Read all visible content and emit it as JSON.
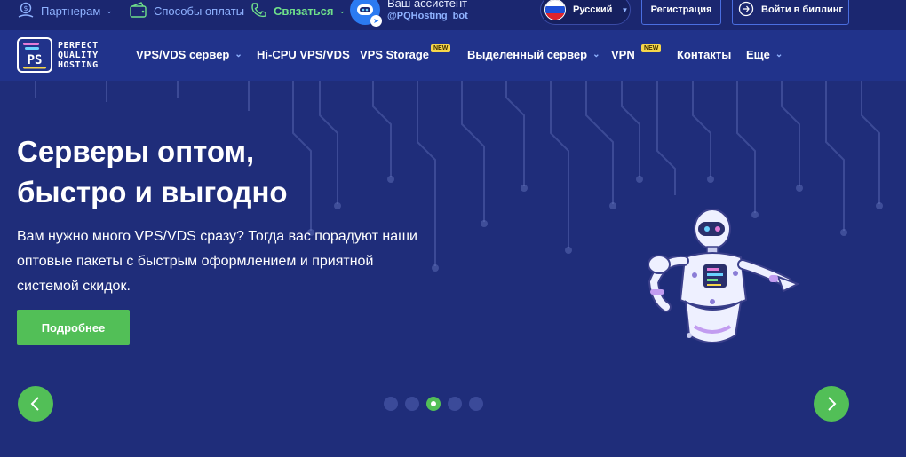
{
  "topbar": {
    "partners": "Партнерам",
    "payment": "Способы оплаты",
    "contact": "Связаться",
    "assistant_title": "Ваш ассистент",
    "assistant_handle": "@PQHosting_bot",
    "language": "Русский",
    "register": "Регистрация",
    "billing": "Войти в биллинг"
  },
  "logo": {
    "line1": "PERFECT",
    "line2": "QUALITY",
    "line3": "HOSTING"
  },
  "nav": {
    "items": [
      {
        "label": "VPS/VDS сервер"
      },
      {
        "label": "Hi-CPU VPS/VDS"
      },
      {
        "label": "VPS Storage"
      },
      {
        "label": "Выделенный сервер"
      },
      {
        "label": "VPN"
      },
      {
        "label": "Контакты"
      },
      {
        "label": "Еще"
      }
    ],
    "new_badge": "NEW"
  },
  "hero": {
    "title_line1": "Серверы оптом,",
    "title_line2": "быстро и выгодно",
    "subtitle": "Вам нужно много VPS/VDS сразу? Тогда вас порадуют наши оптовые пакеты с быстрым оформлением и приятной системой скидок.",
    "button": "Подробнее"
  },
  "slider": {
    "count": 5,
    "active": 3
  },
  "colors": {
    "background": "#1f2d7a",
    "accent_green": "#52bf57",
    "link_blue": "#8fb2ff",
    "contact_green": "#6fe08a",
    "badge_yellow": "#f6d64a"
  },
  "icons": {
    "partners": "dollar-hand-icon",
    "payment": "wallet-icon",
    "contact": "phone-icon",
    "assistant": "robot-avatar-icon",
    "billing": "login-arrow-icon",
    "prev": "chevron-left-icon",
    "next": "chevron-right-icon"
  }
}
